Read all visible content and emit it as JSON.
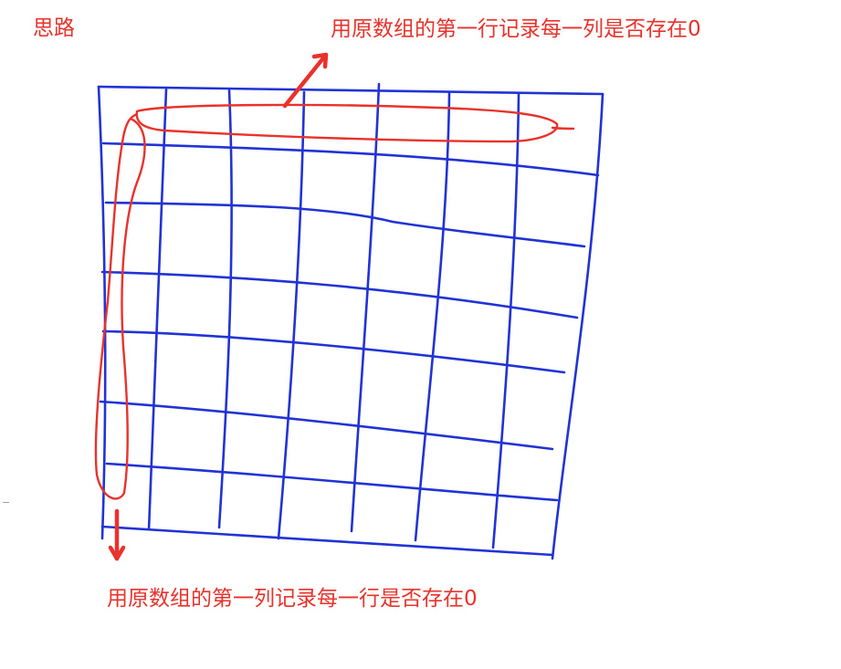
{
  "title": "思路",
  "annotations": {
    "top": "用原数组的第一行记录每一列是否存在0",
    "bottom": "用原数组的第一列记录每一行是否存在0"
  },
  "colors": {
    "grid": "#2233d6",
    "highlight": "#e8322b",
    "text": "#e8322b"
  }
}
